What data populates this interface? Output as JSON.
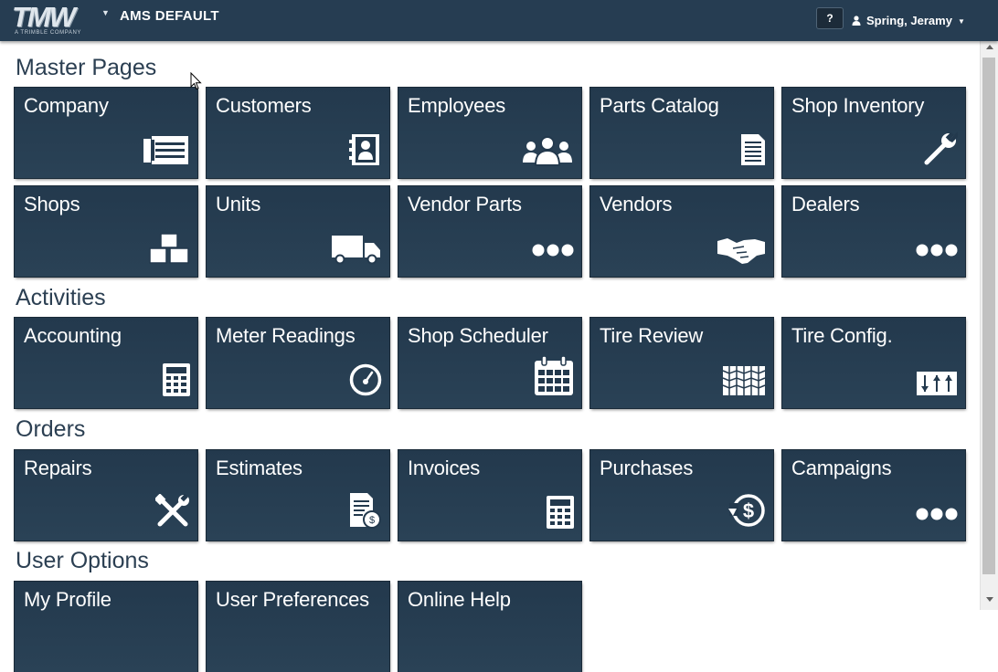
{
  "header": {
    "logo_text": "TMW",
    "logo_subtext": "A TRIMBLE COMPANY",
    "environment_title": "AMS DEFAULT",
    "help_label": "?",
    "user_name": "Spring, Jeramy"
  },
  "sections": {
    "master_pages": {
      "title": "Master Pages",
      "tiles": [
        {
          "label": "Company",
          "icon": "company-card-icon"
        },
        {
          "label": "Customers",
          "icon": "address-book-icon"
        },
        {
          "label": "Employees",
          "icon": "people-icon"
        },
        {
          "label": "Parts Catalog",
          "icon": "document-icon"
        },
        {
          "label": "Shop Inventory",
          "icon": "wrench-icon"
        },
        {
          "label": "Shops",
          "icon": "boxes-icon"
        },
        {
          "label": "Units",
          "icon": "truck-icon"
        },
        {
          "label": "Vendor Parts",
          "icon": "more-dots-icon"
        },
        {
          "label": "Vendors",
          "icon": "handshake-icon"
        },
        {
          "label": "Dealers",
          "icon": "more-dots-icon"
        }
      ]
    },
    "activities": {
      "title": "Activities",
      "tiles": [
        {
          "label": "Accounting",
          "icon": "calculator-icon"
        },
        {
          "label": "Meter Readings",
          "icon": "gauge-icon"
        },
        {
          "label": "Shop Scheduler",
          "icon": "calendar-icon"
        },
        {
          "label": "Tire Review",
          "icon": "tire-tread-icon"
        },
        {
          "label": "Tire Config.",
          "icon": "sliders-icon"
        }
      ]
    },
    "orders": {
      "title": "Orders",
      "tiles": [
        {
          "label": "Repairs",
          "icon": "tools-icon"
        },
        {
          "label": "Estimates",
          "icon": "estimate-document-icon"
        },
        {
          "label": "Invoices",
          "icon": "calculator-icon"
        },
        {
          "label": "Purchases",
          "icon": "dollar-history-icon"
        },
        {
          "label": "Campaigns",
          "icon": "more-dots-icon"
        }
      ]
    },
    "user_options": {
      "title": "User Options",
      "tiles": [
        {
          "label": "My Profile"
        },
        {
          "label": "User Preferences"
        },
        {
          "label": "Online Help"
        }
      ]
    }
  },
  "colors": {
    "header_bg": "#263d52",
    "tile_bg": "#23394d",
    "section_title": "#2b3f52"
  }
}
